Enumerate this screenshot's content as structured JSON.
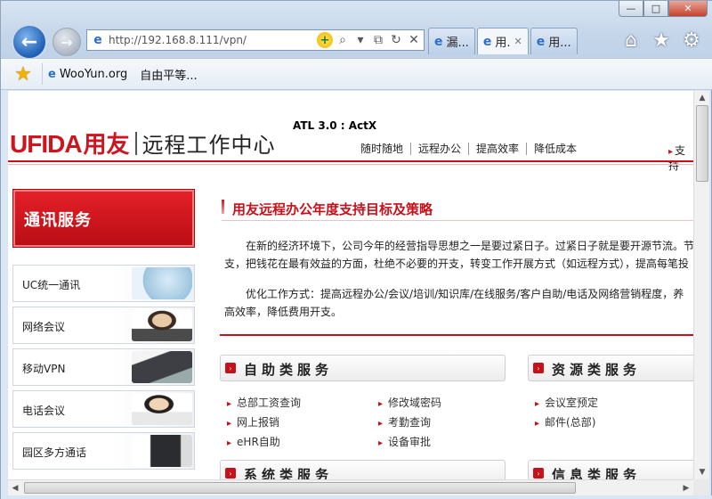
{
  "browser": {
    "window_buttons": {
      "minimize": "—",
      "maximize": "□",
      "close": "✕"
    },
    "address": {
      "url": "http://192.168.8.111/vpn/"
    },
    "tabs": [
      {
        "label": "漏...",
        "active": false
      },
      {
        "label": "用.",
        "active": true
      },
      {
        "label": "用...",
        "active": false
      }
    ],
    "favorites": [
      {
        "label": "WooYun.org"
      },
      {
        "label": "自由平等..."
      }
    ]
  },
  "page": {
    "activex_text": "ATL 3.0 : ActX",
    "logo": {
      "brand": "UFIDA",
      "brand_cn": "用友",
      "tagline": "远程工作中心"
    },
    "topnav": [
      "随时随地",
      "远程办公",
      "提高效率",
      "降低成本"
    ],
    "support_link": "支持",
    "sidebar": {
      "heading": "通讯服务",
      "items": [
        {
          "label": "UC统一通讯"
        },
        {
          "label": "网络会议"
        },
        {
          "label": "移动VPN"
        },
        {
          "label": "电话会议"
        },
        {
          "label": "园区多方通话"
        }
      ]
    },
    "article": {
      "title": "用友远程办公年度支持目标及策略",
      "para1_line1": "　　在新的经济环境下，公司今年的经营指导思想之一是要过紧日子。过紧日子就是要开源节流。节",
      "para1_line2": "支，把钱花在最有效益的方面，杜绝不必要的开支，转变工作开展方式（如远程方式），提高每笔投",
      "para2_line1": "　　优化工作方式：提高远程办公/会议/培训/知识库/在线服务/客户自助/电话及网络营销程度，养",
      "para2_line2": "高效率，降低费用开支。"
    },
    "services": {
      "self": {
        "title": "自助类服务",
        "col1": [
          "总部工资查询",
          "网上报销",
          "eHR自助"
        ],
        "col2": [
          "修改域密码",
          "考勤查询",
          "设备审批"
        ]
      },
      "resource": {
        "title": "资源类服务",
        "col1": [
          "会议室预定",
          "邮件(总部)"
        ]
      },
      "system": {
        "title": "系统类服务"
      },
      "info": {
        "title": "信息类服务"
      }
    }
  }
}
